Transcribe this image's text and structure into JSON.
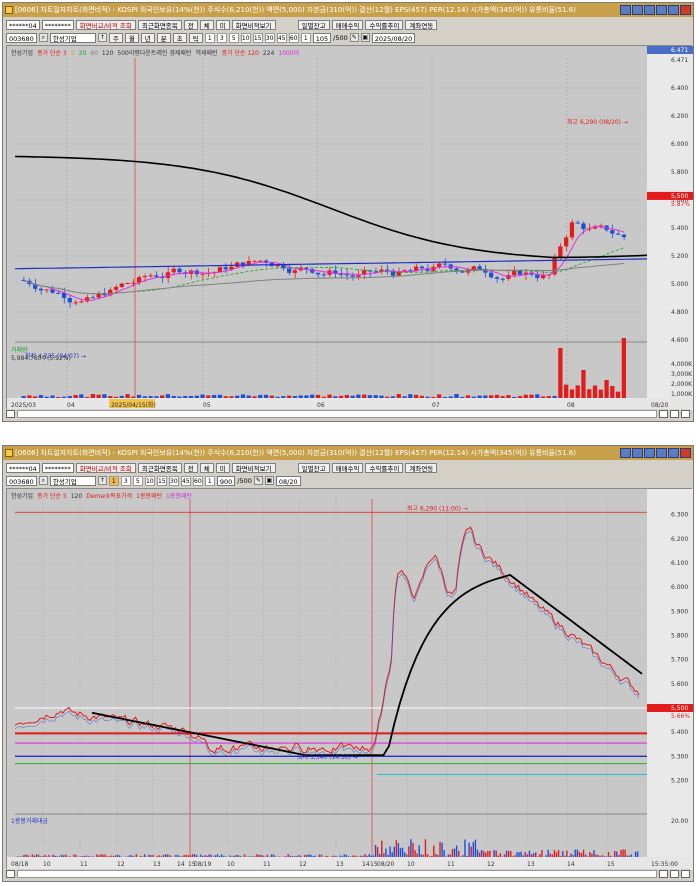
{
  "win1": {
    "title": "[0606] 차트일자차트(화면비적) - KOSPI 외국인보유(14%(천)) 주식수(6,210(천)) 액면(5,000) 자본금(310(억)) 결산(12월) EPS(457) PER(12.14) 시가총액(345(억)) 유통비율(51.6)",
    "toolbar1": [
      "******04",
      "********",
      "화면비교/비적 조회",
      "최근화면종목",
      "전",
      "체",
      "미",
      "화면비적보기",
      "일별잔고",
      "매매수익",
      "수익률추이",
      "계좌연동"
    ],
    "toolbar2": {
      "code": "003680",
      "name": "한성기업",
      "intervals": [
        "1",
        "3",
        "5",
        "10",
        "15",
        "30",
        "45",
        "60",
        "1"
      ],
      "count": "105",
      "total": "/500",
      "date": "2025/08/20",
      "period_btns": [
        "주",
        "월",
        "년",
        "분",
        "초",
        "틱"
      ]
    },
    "legend": [
      "한성기업",
      "종가 단순 3",
      "5",
      "20",
      "60",
      "120",
      "500이평다운트레인 경제패턴",
      "역세패턴",
      "종가 단순 120",
      "224",
      "1000이"
    ],
    "price_labels": [
      "6.471",
      "6.400",
      "6.200",
      "6.000",
      "5.800",
      "5.600",
      "5.400",
      "5.200",
      "5.000",
      "4.800",
      "4.600"
    ],
    "vol_labels": [
      "4,000K",
      "3,000K",
      "2,000K",
      "1,000K"
    ],
    "last_price": "5,500",
    "last_pct": "5.87%",
    "high_ann": "최고 6,290 (08/20) →",
    "low_ann": "최저 4,735 (04/07) →",
    "vol_text": "거래량",
    "vol_value": "5,984,760주(5.92%)",
    "x_labels": [
      "2025/03",
      "04",
      "2025/04/15(화)",
      "05",
      "06",
      "07",
      "08",
      "08/20"
    ]
  },
  "win2": {
    "title": "[0606] 차트일자차트(화면비적) - KOSPI 외국인보유(14%(천)) 주식수(6,210(천)) 액면(5,000) 자본금(310(억)) 결산(12월) EPS(457) PER(12.14) 시가총액(345(억)) 유통비율(51.6)",
    "toolbar1": [
      "******04",
      "********",
      "화면비교/비적 조회",
      "최근화면종목",
      "전",
      "체",
      "미",
      "화면비적보기",
      "일별잔고",
      "매매수익",
      "수익률추이",
      "계좌연동"
    ],
    "toolbar2": {
      "code": "003680",
      "name": "한성기업",
      "intervals": [
        "1",
        "3",
        "5",
        "10",
        "15",
        "30",
        "45",
        "60",
        "1"
      ],
      "count": "900",
      "total": "/500",
      "date": "08/20"
    },
    "legend": [
      "한성기업",
      "종가 단순 5",
      "120",
      "Demark목표가격",
      "1봉봉패턴",
      "1봉봉패턴"
    ],
    "price_labels": [
      "6.300",
      "6.200",
      "6.100",
      "6.000",
      "5.900",
      "5.800",
      "5.700",
      "5.600",
      "5.500",
      "5.400",
      "5.300",
      "5.200"
    ],
    "last_price": "5,500",
    "last_pct": "5.66%",
    "high_ann": "최고 6,290 (11:00) →",
    "low_ann": "최저 5,340 (14:50) →",
    "vol_text": "1봉봉거래대금",
    "vol_value": "20.00",
    "x_labels": [
      "08/18",
      "10",
      "11",
      "12",
      "13",
      "14",
      "15",
      "08/19",
      "10",
      "11",
      "12",
      "13",
      "14",
      "15",
      "08/20",
      "10",
      "11",
      "12",
      "13",
      "14",
      "15"
    ],
    "x_end": "15:35:00"
  },
  "colors": {
    "title": "#c9a04a",
    "up": "#e31b1b",
    "down": "#1f4fd6",
    "ma_black": "#000000",
    "bg": "#c8c8c8"
  },
  "icons": {
    "close": "close-icon",
    "minimize": "minimize-icon",
    "maximize": "maximize-icon"
  }
}
